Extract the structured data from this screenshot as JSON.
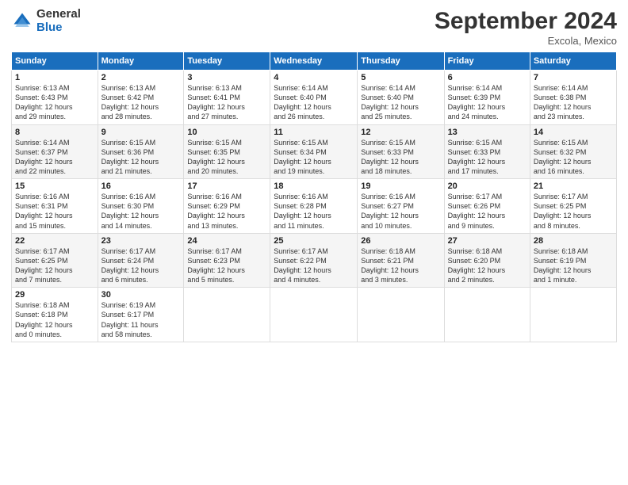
{
  "logo": {
    "general": "General",
    "blue": "Blue"
  },
  "title": "September 2024",
  "location": "Excola, Mexico",
  "days_header": [
    "Sunday",
    "Monday",
    "Tuesday",
    "Wednesday",
    "Thursday",
    "Friday",
    "Saturday"
  ],
  "weeks": [
    [
      {
        "day": "1",
        "info": "Sunrise: 6:13 AM\nSunset: 6:43 PM\nDaylight: 12 hours\nand 29 minutes."
      },
      {
        "day": "2",
        "info": "Sunrise: 6:13 AM\nSunset: 6:42 PM\nDaylight: 12 hours\nand 28 minutes."
      },
      {
        "day": "3",
        "info": "Sunrise: 6:13 AM\nSunset: 6:41 PM\nDaylight: 12 hours\nand 27 minutes."
      },
      {
        "day": "4",
        "info": "Sunrise: 6:14 AM\nSunset: 6:40 PM\nDaylight: 12 hours\nand 26 minutes."
      },
      {
        "day": "5",
        "info": "Sunrise: 6:14 AM\nSunset: 6:40 PM\nDaylight: 12 hours\nand 25 minutes."
      },
      {
        "day": "6",
        "info": "Sunrise: 6:14 AM\nSunset: 6:39 PM\nDaylight: 12 hours\nand 24 minutes."
      },
      {
        "day": "7",
        "info": "Sunrise: 6:14 AM\nSunset: 6:38 PM\nDaylight: 12 hours\nand 23 minutes."
      }
    ],
    [
      {
        "day": "8",
        "info": "Sunrise: 6:14 AM\nSunset: 6:37 PM\nDaylight: 12 hours\nand 22 minutes."
      },
      {
        "day": "9",
        "info": "Sunrise: 6:15 AM\nSunset: 6:36 PM\nDaylight: 12 hours\nand 21 minutes."
      },
      {
        "day": "10",
        "info": "Sunrise: 6:15 AM\nSunset: 6:35 PM\nDaylight: 12 hours\nand 20 minutes."
      },
      {
        "day": "11",
        "info": "Sunrise: 6:15 AM\nSunset: 6:34 PM\nDaylight: 12 hours\nand 19 minutes."
      },
      {
        "day": "12",
        "info": "Sunrise: 6:15 AM\nSunset: 6:33 PM\nDaylight: 12 hours\nand 18 minutes."
      },
      {
        "day": "13",
        "info": "Sunrise: 6:15 AM\nSunset: 6:33 PM\nDaylight: 12 hours\nand 17 minutes."
      },
      {
        "day": "14",
        "info": "Sunrise: 6:15 AM\nSunset: 6:32 PM\nDaylight: 12 hours\nand 16 minutes."
      }
    ],
    [
      {
        "day": "15",
        "info": "Sunrise: 6:16 AM\nSunset: 6:31 PM\nDaylight: 12 hours\nand 15 minutes."
      },
      {
        "day": "16",
        "info": "Sunrise: 6:16 AM\nSunset: 6:30 PM\nDaylight: 12 hours\nand 14 minutes."
      },
      {
        "day": "17",
        "info": "Sunrise: 6:16 AM\nSunset: 6:29 PM\nDaylight: 12 hours\nand 13 minutes."
      },
      {
        "day": "18",
        "info": "Sunrise: 6:16 AM\nSunset: 6:28 PM\nDaylight: 12 hours\nand 11 minutes."
      },
      {
        "day": "19",
        "info": "Sunrise: 6:16 AM\nSunset: 6:27 PM\nDaylight: 12 hours\nand 10 minutes."
      },
      {
        "day": "20",
        "info": "Sunrise: 6:17 AM\nSunset: 6:26 PM\nDaylight: 12 hours\nand 9 minutes."
      },
      {
        "day": "21",
        "info": "Sunrise: 6:17 AM\nSunset: 6:25 PM\nDaylight: 12 hours\nand 8 minutes."
      }
    ],
    [
      {
        "day": "22",
        "info": "Sunrise: 6:17 AM\nSunset: 6:25 PM\nDaylight: 12 hours\nand 7 minutes."
      },
      {
        "day": "23",
        "info": "Sunrise: 6:17 AM\nSunset: 6:24 PM\nDaylight: 12 hours\nand 6 minutes."
      },
      {
        "day": "24",
        "info": "Sunrise: 6:17 AM\nSunset: 6:23 PM\nDaylight: 12 hours\nand 5 minutes."
      },
      {
        "day": "25",
        "info": "Sunrise: 6:17 AM\nSunset: 6:22 PM\nDaylight: 12 hours\nand 4 minutes."
      },
      {
        "day": "26",
        "info": "Sunrise: 6:18 AM\nSunset: 6:21 PM\nDaylight: 12 hours\nand 3 minutes."
      },
      {
        "day": "27",
        "info": "Sunrise: 6:18 AM\nSunset: 6:20 PM\nDaylight: 12 hours\nand 2 minutes."
      },
      {
        "day": "28",
        "info": "Sunrise: 6:18 AM\nSunset: 6:19 PM\nDaylight: 12 hours\nand 1 minute."
      }
    ],
    [
      {
        "day": "29",
        "info": "Sunrise: 6:18 AM\nSunset: 6:18 PM\nDaylight: 12 hours\nand 0 minutes."
      },
      {
        "day": "30",
        "info": "Sunrise: 6:19 AM\nSunset: 6:17 PM\nDaylight: 11 hours\nand 58 minutes."
      },
      null,
      null,
      null,
      null,
      null
    ]
  ]
}
